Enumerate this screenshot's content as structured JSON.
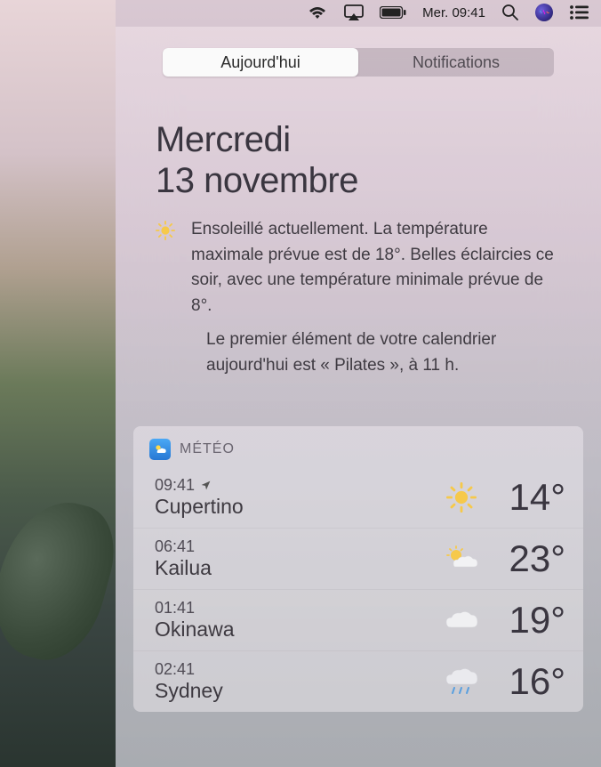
{
  "menubar": {
    "datetime": "Mer. 09:41"
  },
  "tabs": {
    "today": "Aujourd'hui",
    "notifications": "Notifications"
  },
  "date": {
    "line1": "Mercredi",
    "line2": "13 novembre"
  },
  "summary": {
    "weather_text": "Ensoleillé actuellement. La température maximale prévue est de 18°. Belles éclaircies ce soir, avec une température minimale prévue de 8°.",
    "calendar_text": "Le premier élément de votre calendrier aujourd'hui est « Pilates », à 11 h."
  },
  "weather_widget": {
    "title": "MÉTÉO",
    "locations": [
      {
        "time": "09:41",
        "current": true,
        "name": "Cupertino",
        "icon": "sunny",
        "temp": "14°"
      },
      {
        "time": "06:41",
        "current": false,
        "name": "Kailua",
        "icon": "partly",
        "temp": "23°"
      },
      {
        "time": "01:41",
        "current": false,
        "name": "Okinawa",
        "icon": "cloudy",
        "temp": "19°"
      },
      {
        "time": "02:41",
        "current": false,
        "name": "Sydney",
        "icon": "rain",
        "temp": "16°"
      }
    ]
  }
}
